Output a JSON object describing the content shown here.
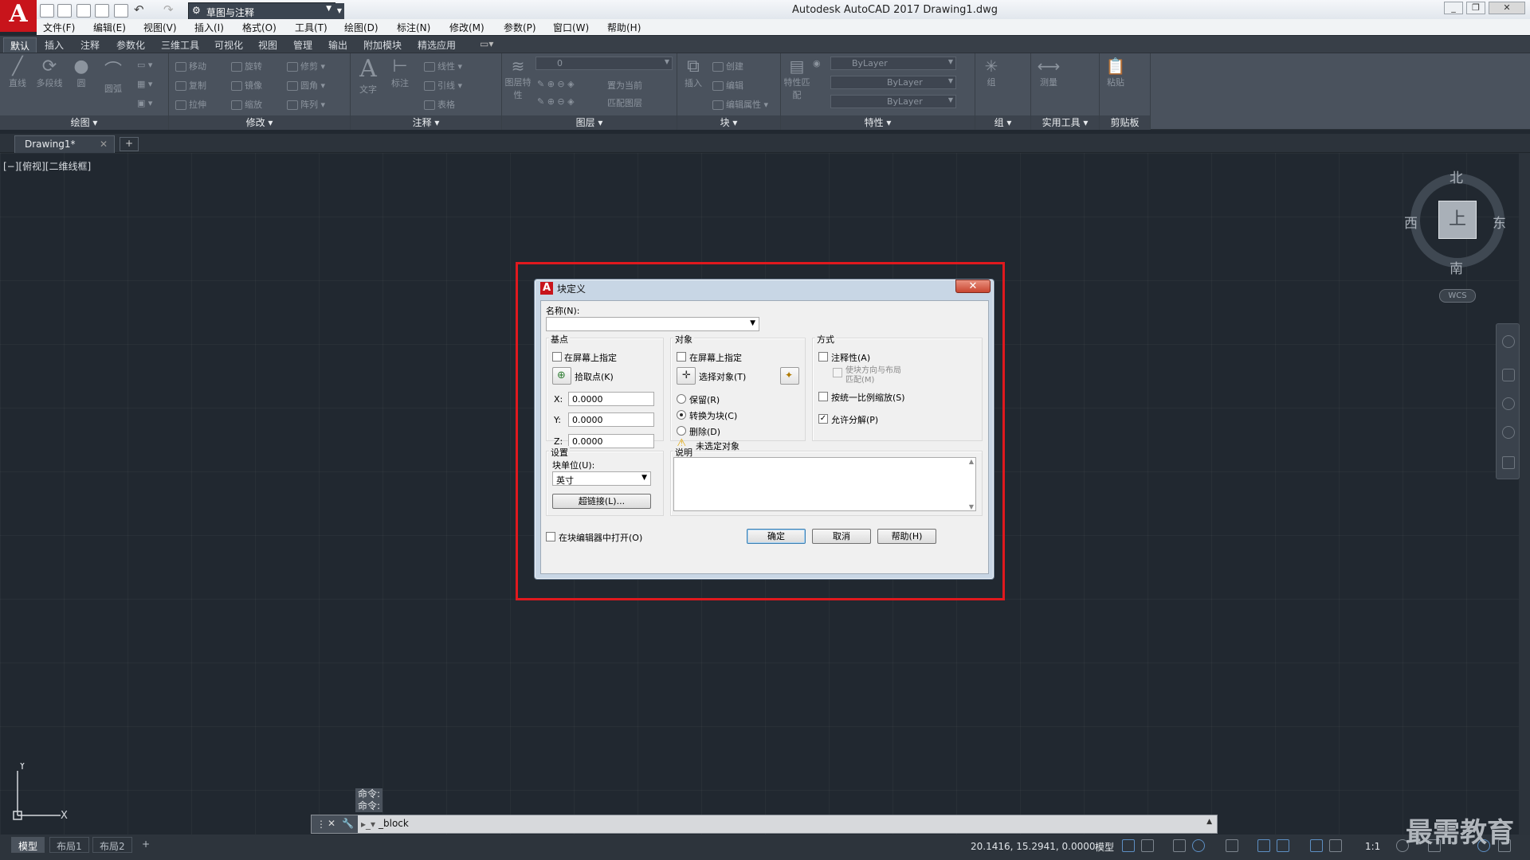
{
  "titlebar": {
    "workspace": "草图与注释",
    "title": "Autodesk AutoCAD 2017    Drawing1.dwg",
    "app_logo": "A"
  },
  "menu": [
    "文件(F)",
    "编辑(E)",
    "视图(V)",
    "插入(I)",
    "格式(O)",
    "工具(T)",
    "绘图(D)",
    "标注(N)",
    "修改(M)",
    "参数(P)",
    "窗口(W)",
    "帮助(H)"
  ],
  "ribbon_tabs": [
    "默认",
    "插入",
    "注释",
    "参数化",
    "三维工具",
    "可视化",
    "视图",
    "管理",
    "输出",
    "附加模块",
    "精选应用"
  ],
  "ribbon": {
    "draw": {
      "title": "绘图",
      "tools": [
        "直线",
        "多段线",
        "圆",
        "圆弧"
      ]
    },
    "modify": {
      "title": "修改",
      "tools": [
        "移动",
        "旋转",
        "修剪",
        "复制",
        "镜像",
        "圆角",
        "拉伸",
        "缩放",
        "阵列"
      ]
    },
    "annotate": {
      "title": "注释",
      "tools": [
        "文字",
        "标注",
        "线性",
        "引线",
        "表格"
      ]
    },
    "layers": {
      "title": "图层",
      "tools": [
        "图层特性",
        "置为当前",
        "匹配图层"
      ],
      "current_layer": "0"
    },
    "block": {
      "title": "块",
      "tools": [
        "插入",
        "创建",
        "编辑",
        "编辑属性"
      ]
    },
    "properties": {
      "title": "特性",
      "tools": [
        "特性匹配"
      ],
      "color": "ByLayer",
      "linetype": "ByLayer",
      "lineweight": "ByLayer"
    },
    "groups": {
      "title": "组",
      "tools": [
        "组"
      ]
    },
    "utilities": {
      "title": "实用工具",
      "tools": [
        "测量"
      ]
    },
    "clipboard": {
      "title": "剪贴板",
      "tools": [
        "粘贴"
      ]
    }
  },
  "doc_tab": "Drawing1*",
  "viewport_label": "[−][俯视][二维线框]",
  "viewcube": {
    "north": "北",
    "south": "南",
    "east": "东",
    "west": "西",
    "face": "上",
    "wcs": "WCS"
  },
  "ucs": {
    "x": "X",
    "y": "Y"
  },
  "dialog": {
    "title": "块定义",
    "close": "✕",
    "name_label": "名称(N):",
    "name_value": "",
    "basepoint": {
      "title": "基点",
      "specify_onscreen": "在屏幕上指定",
      "pick_point": "拾取点(K)",
      "x_label": "X:",
      "x_value": "0.0000",
      "y_label": "Y:",
      "y_value": "0.0000",
      "z_label": "Z:",
      "z_value": "0.0000"
    },
    "objects": {
      "title": "对象",
      "specify_onscreen": "在屏幕上指定",
      "select_objects": "选择对象(T)",
      "retain": "保留(R)",
      "convert": "转换为块(C)",
      "delete": "删除(D)",
      "warning": "未选定对象"
    },
    "behavior": {
      "title": "方式",
      "annotative": "注释性(A)",
      "match_orientation": "使块方向与布局\n匹配(M)",
      "scale_uniformly": "按统一比例缩放(S)",
      "allow_explode": "允许分解(P)"
    },
    "settings": {
      "title": "设置",
      "unit_label": "块单位(U):",
      "unit_value": "英寸",
      "hyperlink": "超链接(L)..."
    },
    "description_label": "说明",
    "open_in_editor": "在块编辑器中打开(O)",
    "ok": "确定",
    "cancel": "取消",
    "help": "帮助(H)"
  },
  "command": {
    "history": [
      "命令:",
      "命令:"
    ],
    "input": "_block"
  },
  "status": {
    "layouts": [
      "模型",
      "布局1",
      "布局2"
    ],
    "coords": "20.1416, 15.2941, 0.0000",
    "model": "模型",
    "scale": "1:1"
  },
  "watermark": "最需教育"
}
